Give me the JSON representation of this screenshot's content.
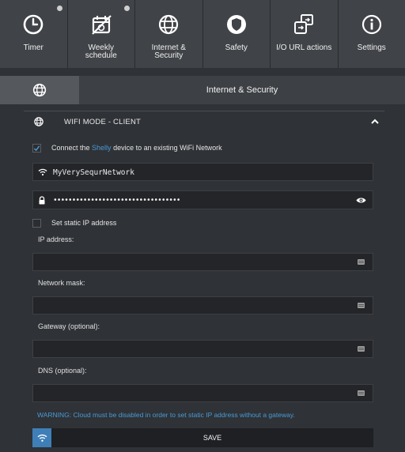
{
  "nav": {
    "items": [
      {
        "label": "Timer",
        "icon": "clock-icon",
        "dot": true
      },
      {
        "label": "Weekly\nschedule",
        "icon": "calendar-off-icon",
        "dot": true
      },
      {
        "label": "Internet &\nSecurity",
        "icon": "globe-icon",
        "dot": false
      },
      {
        "label": "Safety",
        "icon": "shield-icon",
        "dot": false
      },
      {
        "label": "I/O URL actions",
        "icon": "url-actions-icon",
        "dot": false
      },
      {
        "label": "Settings",
        "icon": "info-icon",
        "dot": false
      }
    ]
  },
  "section": {
    "title": "Internet & Security",
    "icon": "globe-icon"
  },
  "wifi_mode": {
    "title": "WIFI MODE - CLIENT",
    "connect": {
      "checked": true,
      "text_before": "Connect the ",
      "link": "Shelly",
      "text_after": " device to an existing WiFi Network"
    },
    "ssid_value": "MyVerySequrNetwork",
    "password_value": "••••••••••••••••••••••••••••••••••",
    "static_ip": {
      "checked": false,
      "label": "Set static IP address"
    },
    "ip_label": "IP address:",
    "mask_label": "Network mask:",
    "gateway_label": "Gateway (optional):",
    "dns_label": "DNS (optional):",
    "warning": "WARNING: Cloud must be disabled in order to set static IP address without a gateway.",
    "save_label": "SAVE"
  },
  "colors": {
    "accent": "#4a9ad6",
    "save_icon_bg": "#3f7fb8",
    "background": "#2f3236"
  }
}
